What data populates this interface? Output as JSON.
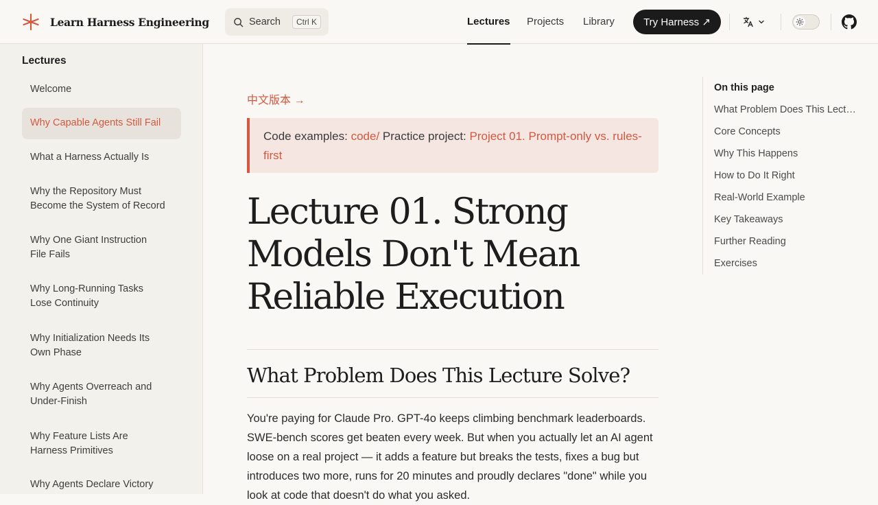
{
  "header": {
    "brand": "Learn Harness Engineering",
    "search": {
      "label": "Search",
      "shortcut": "Ctrl K"
    },
    "nav": [
      {
        "label": "Lectures",
        "active": true
      },
      {
        "label": "Projects",
        "active": false
      },
      {
        "label": "Library",
        "active": false
      }
    ],
    "cta": "Try Harness ↗",
    "icons": [
      "translate-icon",
      "chevron-down-icon",
      "sun-icon",
      "github-icon"
    ]
  },
  "sidebar": {
    "heading": "Lectures",
    "items": [
      {
        "label": "Welcome",
        "active": false
      },
      {
        "label": "Why Capable Agents Still Fail",
        "active": true
      },
      {
        "label": "What a Harness Actually Is",
        "active": false
      },
      {
        "label": "Why the Repository Must Become the System of Record",
        "active": false
      },
      {
        "label": "Why One Giant Instruction File Fails",
        "active": false
      },
      {
        "label": "Why Long-Running Tasks Lose Continuity",
        "active": false
      },
      {
        "label": "Why Initialization Needs Its Own Phase",
        "active": false
      },
      {
        "label": "Why Agents Overreach and Under-Finish",
        "active": false
      },
      {
        "label": "Why Feature Lists Are Harness Primitives",
        "active": false
      },
      {
        "label": "Why Agents Declare Victory",
        "active": false
      }
    ]
  },
  "main": {
    "lang_link": "中文版本 →",
    "callout": {
      "code_prefix": "Code examples: ",
      "code_link": "code/",
      "project_prefix": " Practice project: ",
      "project_link": "Project 01. Prompt-only vs. rules-first"
    },
    "title": "Lecture 01. Strong Models Don't Mean Reliable Execution",
    "section_heading": "What Problem Does This Lecture Solve?",
    "paragraph": "You're paying for Claude Pro. GPT-4o keeps climbing benchmark leaderboards. SWE-bench scores get beaten every week. But when you actually let an AI agent loose on a real project — it adds a feature but breaks the tests, fixes a bug but introduces two more, runs for 20 minutes and proudly declares \"done\" while you look at code that doesn't do what you asked."
  },
  "toc": {
    "title": "On this page",
    "items": [
      "What Problem Does This Lecture Solve?",
      "Core Concepts",
      "Why This Happens",
      "How to Do It Right",
      "Real-World Example",
      "Key Takeaways",
      "Further Reading",
      "Exercises"
    ]
  },
  "colors": {
    "accent": "#d4583f",
    "background": "#f9f8f5",
    "sidebar": "#f3f1ec",
    "callout": "#f5e6e1",
    "dark": "#1b1b1b"
  }
}
